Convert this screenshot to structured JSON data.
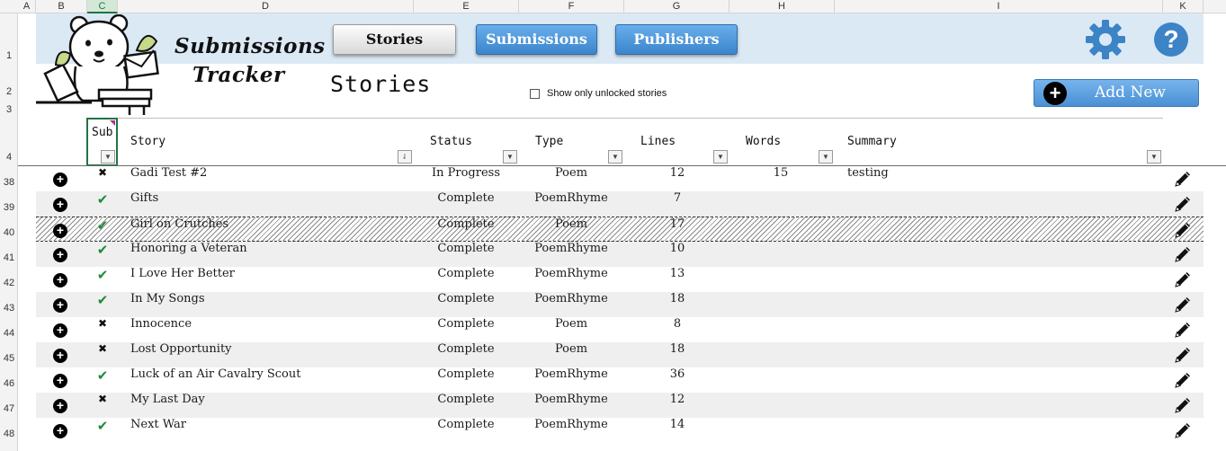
{
  "sheet": {
    "columns": [
      "A",
      "B",
      "C",
      "D",
      "E",
      "F",
      "G",
      "H",
      "I",
      "K"
    ],
    "active_column": "C",
    "rows": [
      "1",
      "2",
      "3",
      "4",
      "38",
      "39",
      "40",
      "41",
      "42",
      "43",
      "44",
      "45",
      "46",
      "47",
      "48"
    ]
  },
  "app": {
    "brand_line1": "Submissions",
    "brand_line2": "Tracker"
  },
  "nav": [
    {
      "label": "Stories",
      "active": true
    },
    {
      "label": "Submissions",
      "active": false
    },
    {
      "label": "Publishers",
      "active": false
    }
  ],
  "icons": {
    "settings": "gear-icon",
    "help": "help-icon",
    "help_glyph": "?",
    "add": "plus-icon",
    "plus_glyph": "+",
    "edit": "pencil-icon",
    "filter_glyph": "▼",
    "sort_glyph": "⇃"
  },
  "page": {
    "title": "Stories",
    "unlocked_label": "Show only unlocked stories",
    "add_new_label": "Add New"
  },
  "table": {
    "headers": {
      "sub": "Sub",
      "story": "Story",
      "status": "Status",
      "type": "Type",
      "lines": "Lines",
      "words": "Words",
      "summary": "Summary"
    },
    "rows": [
      {
        "submitted": false,
        "sub_glyph": "✖",
        "story": "Gadi Test #2",
        "status": "In Progress",
        "type": "Poem",
        "lines": "12",
        "words": "15",
        "summary": "testing"
      },
      {
        "submitted": true,
        "sub_glyph": "✔",
        "story": "Gifts",
        "status": "Complete",
        "type": "PoemRhyme",
        "lines": "7",
        "words": "",
        "summary": ""
      },
      {
        "submitted": true,
        "sub_glyph": "✔",
        "story": "Girl on Crutches",
        "status": "Complete",
        "type": "Poem",
        "lines": "17",
        "words": "",
        "summary": ""
      },
      {
        "submitted": true,
        "sub_glyph": "✔",
        "story": "Honoring a Veteran",
        "status": "Complete",
        "type": "PoemRhyme",
        "lines": "10",
        "words": "",
        "summary": ""
      },
      {
        "submitted": true,
        "sub_glyph": "✔",
        "story": "I Love Her Better",
        "status": "Complete",
        "type": "PoemRhyme",
        "lines": "13",
        "words": "",
        "summary": ""
      },
      {
        "submitted": true,
        "sub_glyph": "✔",
        "story": "In My Songs",
        "status": "Complete",
        "type": "PoemRhyme",
        "lines": "18",
        "words": "",
        "summary": ""
      },
      {
        "submitted": false,
        "sub_glyph": "✖",
        "story": "Innocence",
        "status": "Complete",
        "type": "Poem",
        "lines": "8",
        "words": "",
        "summary": ""
      },
      {
        "submitted": false,
        "sub_glyph": "✖",
        "story": "Lost Opportunity",
        "status": "Complete",
        "type": "Poem",
        "lines": "18",
        "words": "",
        "summary": ""
      },
      {
        "submitted": true,
        "sub_glyph": "✔",
        "story": "Luck of an Air Cavalry Scout",
        "status": "Complete",
        "type": "PoemRhyme",
        "lines": "36",
        "words": "",
        "summary": ""
      },
      {
        "submitted": false,
        "sub_glyph": "✖",
        "story": "My Last Day",
        "status": "Complete",
        "type": "PoemRhyme",
        "lines": "12",
        "words": "",
        "summary": ""
      },
      {
        "submitted": true,
        "sub_glyph": "✔",
        "story": "Next War",
        "status": "Complete",
        "type": "PoemRhyme",
        "lines": "14",
        "words": "",
        "summary": ""
      }
    ]
  },
  "colors": {
    "banner": "#dbe9f5",
    "nav_blue": "#3a85cc",
    "check_green": "#1f8a3a",
    "excel_green": "#217346"
  }
}
